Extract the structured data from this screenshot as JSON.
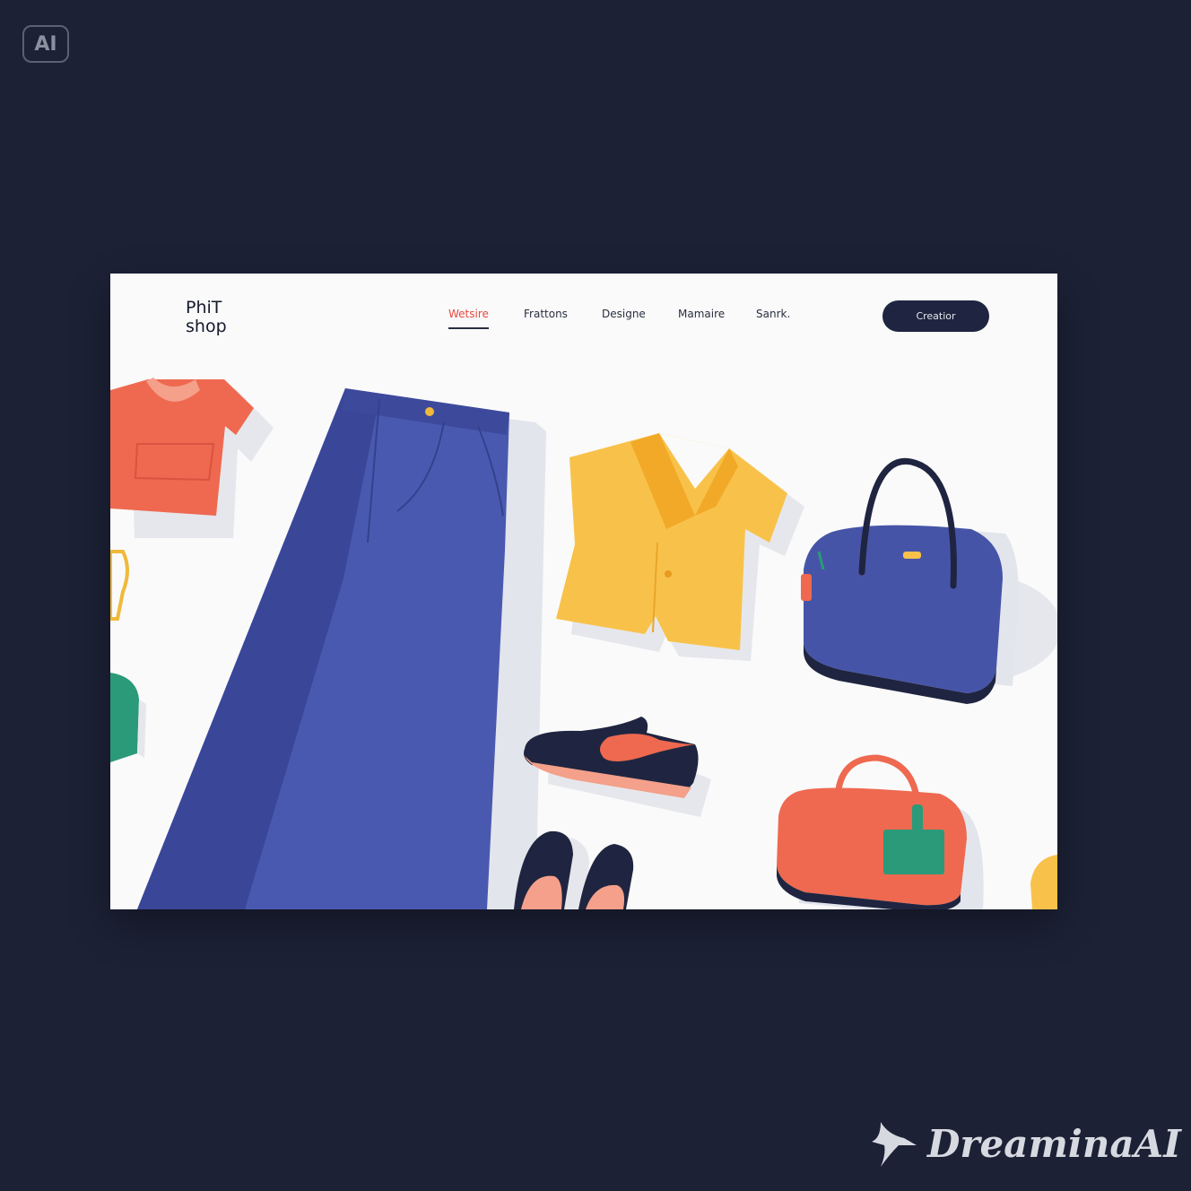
{
  "badge": {
    "label": "AI"
  },
  "header": {
    "logo_line1": "PhiT",
    "logo_line2": "shop",
    "nav": [
      {
        "label": "Wetsire",
        "active": true
      },
      {
        "label": "Frattons",
        "active": false
      },
      {
        "label": "Designe",
        "active": false
      },
      {
        "label": "Mamaire",
        "active": false
      },
      {
        "label": "Sanrk.",
        "active": false
      }
    ],
    "cta_label": "Creatior"
  },
  "colors": {
    "background": "#1c2136",
    "card": "#fafafa",
    "accent_red": "#e8473f",
    "navy": "#1f2540",
    "denim": "#4654a8",
    "yellow": "#f8c24a",
    "coral": "#ee6950",
    "green": "#2a9a78"
  },
  "illustrations": [
    "coral-tshirt-icon",
    "blue-jeans-icon",
    "yellow-shirt-icon",
    "blue-handbag-icon",
    "navy-sneaker-icon",
    "navy-flats-icon",
    "coral-duffel-bag-icon"
  ],
  "watermark": {
    "text": "DreaminaAI"
  }
}
